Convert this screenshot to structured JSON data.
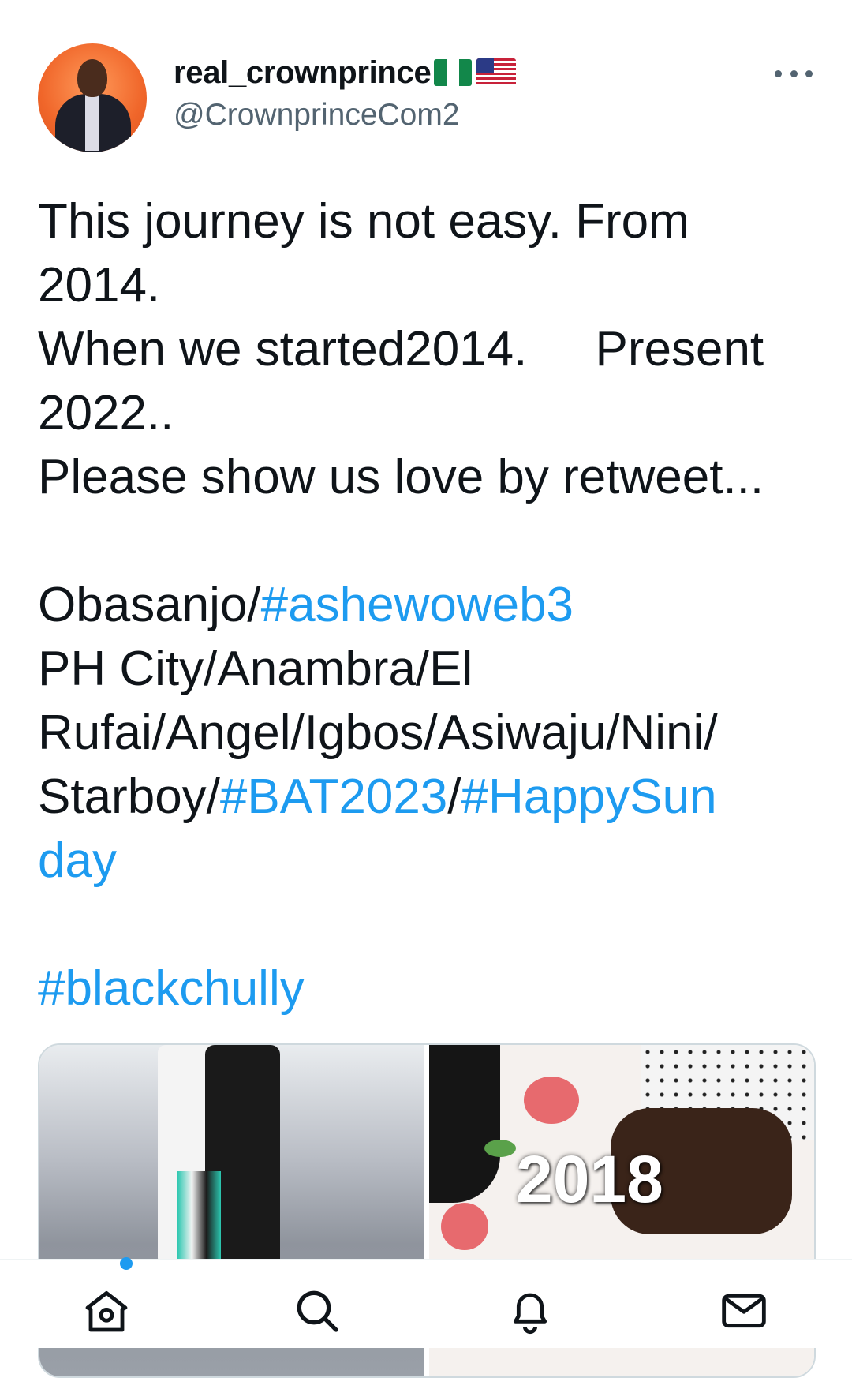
{
  "tweet": {
    "author": {
      "display_name": "real_crownprince",
      "handle": "@CrownprinceCom2",
      "flags": [
        "nigeria-flag",
        "usa-flag"
      ]
    },
    "text_lines": [
      [
        {
          "t": "This journey is not easy. From"
        }
      ],
      [
        {
          "t": "2014."
        }
      ],
      [
        {
          "t": "When we started2014.     Present"
        }
      ],
      [
        {
          "t": "2022.."
        }
      ],
      [
        {
          "t": "Please show us love by retweet..."
        }
      ],
      [
        {
          "t": ""
        }
      ],
      [
        {
          "t": "Obasanjo/"
        },
        {
          "t": "#ashewoweb3",
          "tag": true
        }
      ],
      [
        {
          "t": "PH City/Anambra/El"
        }
      ],
      [
        {
          "t": "Rufai/Angel/Igbos/Asiwaju/Nini/"
        }
      ],
      [
        {
          "t": "Starboy/"
        },
        {
          "t": "#BAT2023",
          "tag": true
        },
        {
          "t": "/"
        },
        {
          "t": "#HappySun",
          "tag": true
        }
      ],
      [
        {
          "t": "day",
          "tag": true
        }
      ],
      [
        {
          "t": ""
        }
      ],
      [
        {
          "t": "#blackchully",
          "tag": true
        }
      ]
    ],
    "media": {
      "photo_right_caption": "2018"
    }
  },
  "tabbar": {
    "items": [
      "home-icon",
      "search-icon",
      "notifications-icon",
      "messages-icon"
    ],
    "home_has_new_dot": true
  },
  "colors": {
    "link": "#1d9bf0",
    "text": "#0f1419",
    "secondary": "#536471",
    "nigeria_green": "#12874a"
  }
}
